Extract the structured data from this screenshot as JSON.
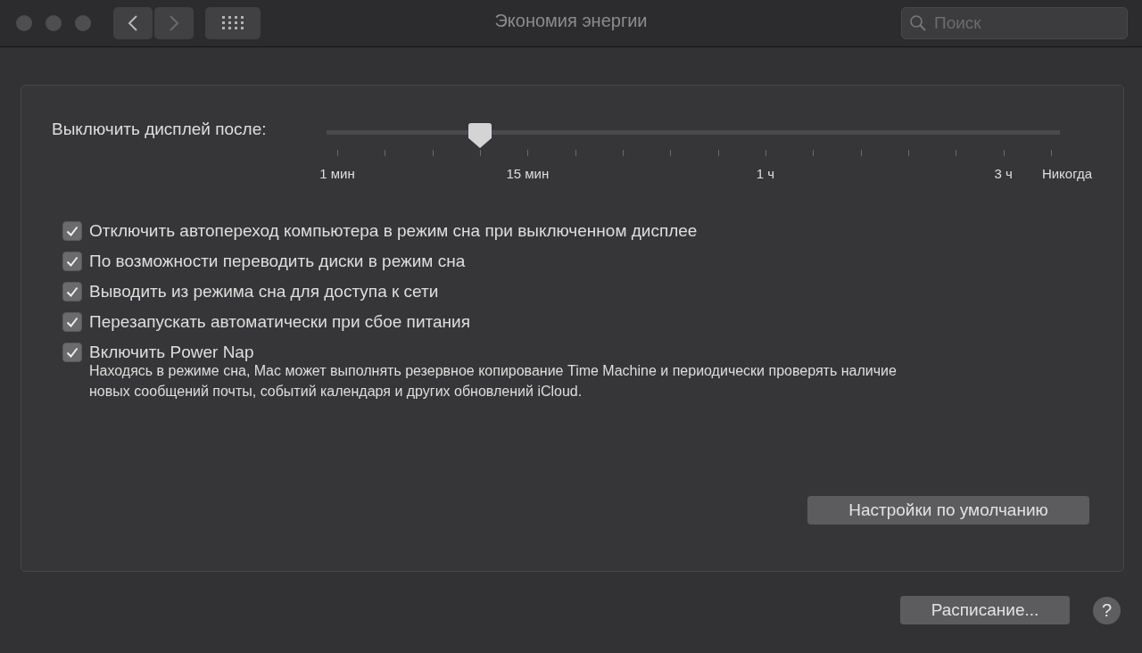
{
  "window": {
    "title": "Экономия энергии",
    "search": {
      "placeholder": "Поиск"
    }
  },
  "display_sleep": {
    "label": "Выключить дисплей после:",
    "level": 0.2,
    "ticks": [
      {
        "kind": "labeled",
        "label": "1 мин"
      },
      {
        "kind": "plain"
      },
      {
        "kind": "plain"
      },
      {
        "kind": "plain"
      },
      {
        "kind": "labeled",
        "label": "15 мин"
      },
      {
        "kind": "plain"
      },
      {
        "kind": "plain"
      },
      {
        "kind": "plain"
      },
      {
        "kind": "plain"
      },
      {
        "kind": "labeled",
        "label": "1 ч"
      },
      {
        "kind": "plain"
      },
      {
        "kind": "plain"
      },
      {
        "kind": "plain"
      },
      {
        "kind": "plain"
      },
      {
        "kind": "labeled",
        "label": "3 ч"
      },
      {
        "kind": "labeled",
        "label": "Никогда"
      }
    ]
  },
  "options": [
    {
      "label": "Отключить автопереход компьютера в режим сна при выключенном дисплее",
      "checked": true
    },
    {
      "label": "По возможности переводить диски в режим сна",
      "checked": true
    },
    {
      "label": "Выводить из режима сна для доступа к сети",
      "checked": true
    },
    {
      "label": "Перезапускать автоматически при сбое питания",
      "checked": true
    },
    {
      "label": "Включить Power Nap",
      "checked": true,
      "description": "Находясь в режиме сна, Mac может выполнять резервное копирование Time Machine и периодически проверять наличие новых сообщений почты, событий календаря и других обновлений iCloud."
    }
  ],
  "defaults_button": "Настройки по умолчанию",
  "schedule_button": "Расписание...",
  "help_button": "?"
}
